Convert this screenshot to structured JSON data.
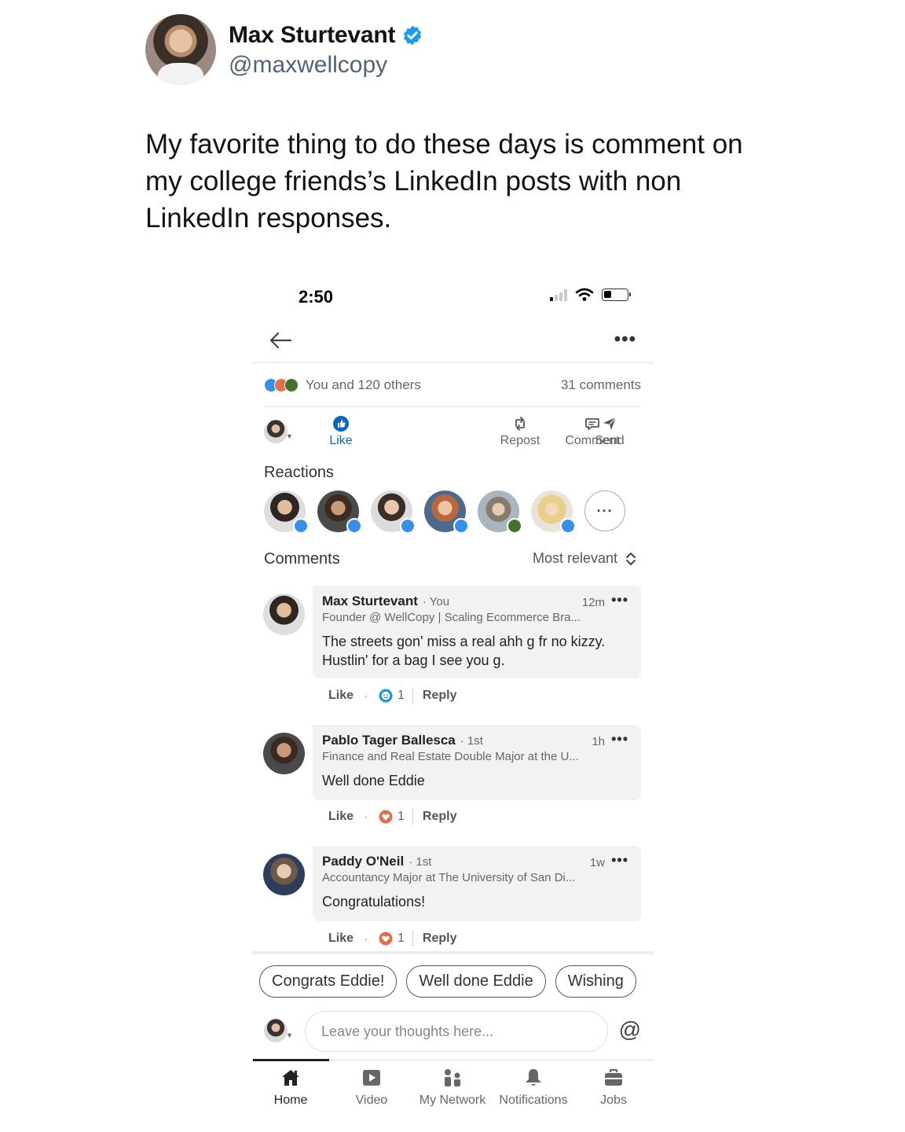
{
  "tweet": {
    "name": "Max Sturtevant",
    "handle": "@maxwellcopy",
    "text": "My favorite thing to do these days is comment on my college friends’s LinkedIn posts with non LinkedIn responses."
  },
  "phone": {
    "status_time": "2:50",
    "social": {
      "reactions_text": "You and 120 others",
      "comments_text": "31 comments"
    },
    "actions": {
      "like": "Like",
      "comment": "Comment",
      "repost": "Repost",
      "send": "Send"
    },
    "reactions_title": "Reactions",
    "comments_title": "Comments",
    "sort_label": "Most relevant",
    "comments": [
      {
        "name": "Max Sturtevant",
        "degree": "· You",
        "time": "12m",
        "headline": "Founder @ WellCopy | Scaling Ecommerce Bra...",
        "body_line1": "The streets gon' miss a real ahh g fr no kizzy.",
        "body_line2": "Hustlin' for a bag I see you g.",
        "like": "Like",
        "dot": "·",
        "reaction_count": "1",
        "reaction_type": "funny",
        "reply": "Reply"
      },
      {
        "name": "Pablo Tager Ballesca",
        "degree": "· 1st",
        "time": "1h",
        "headline": "Finance and Real Estate Double Major at the U...",
        "body_line1": "Well done Eddie",
        "like": "Like",
        "dot": "·",
        "reaction_count": "1",
        "reaction_type": "love",
        "reply": "Reply"
      },
      {
        "name": "Paddy O'Neil",
        "degree": "· 1st",
        "time": "1w",
        "headline": "Accountancy Major at The University of San Di...",
        "body_line1": "Congratulations!",
        "like": "Like",
        "dot": "·",
        "reaction_count": "1",
        "reaction_type": "love",
        "reply": "Reply"
      }
    ],
    "chips": [
      "Congrats Eddie!",
      "Well done Eddie",
      "Wishing"
    ],
    "input_placeholder": "Leave your thoughts here...",
    "at_symbol": "@",
    "tabs": {
      "home": "Home",
      "video": "Video",
      "network": "My Network",
      "notifications": "Notifications",
      "jobs": "Jobs"
    }
  },
  "colors": {
    "verified": "#1d9bf0",
    "linkedin_blue": "#0a66c2",
    "like_reaction": "#378fe9",
    "love_reaction": "#df704d",
    "celebrate_reaction": "#44712e"
  }
}
